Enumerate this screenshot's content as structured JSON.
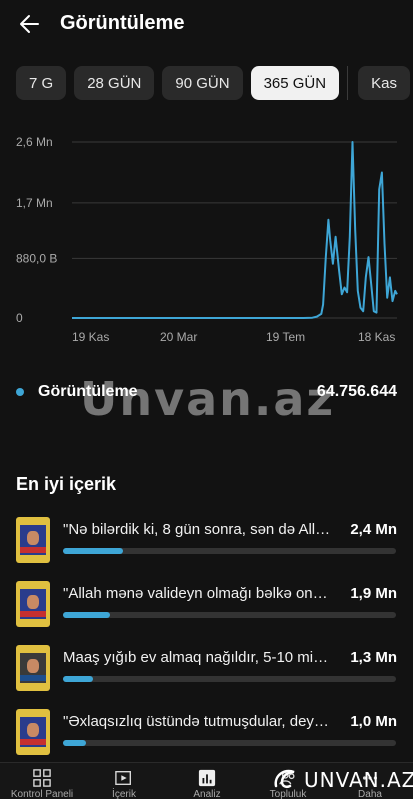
{
  "header": {
    "title": "Görüntüleme",
    "back_icon": "arrow-left-icon"
  },
  "range_chips": [
    {
      "label": "7 G",
      "active": false
    },
    {
      "label": "28 GÜN",
      "active": false
    },
    {
      "label": "90 GÜN",
      "active": false
    },
    {
      "label": "365 GÜN",
      "active": true
    },
    {
      "label": "Kas",
      "active": false
    }
  ],
  "chart_data": {
    "type": "line",
    "y_ticks": [
      "2,6 Mn",
      "1,7 Mn",
      "880,0 B",
      "0"
    ],
    "y_tick_values": [
      2600000,
      1700000,
      880000,
      0
    ],
    "x_ticks": [
      "19 Kas",
      "20 Mar",
      "19 Tem",
      "18 Kas"
    ],
    "ylim": [
      0,
      2600000
    ],
    "xlim": [
      0,
      365
    ],
    "series": [
      {
        "color": "#3ea6d6",
        "x": [
          0,
          30,
          60,
          90,
          120,
          150,
          180,
          210,
          240,
          260,
          270,
          275,
          280,
          282,
          285,
          288,
          290,
          293,
          296,
          300,
          303,
          306,
          309,
          312,
          315,
          318,
          321,
          324,
          327,
          330,
          333,
          336,
          339,
          342,
          345,
          348,
          351,
          354,
          357,
          360,
          363,
          365
        ],
        "y": [
          0,
          0,
          0,
          0,
          0,
          0,
          0,
          0,
          0,
          0,
          5000,
          20000,
          60000,
          200000,
          900000,
          1450000,
          1150000,
          800000,
          1200000,
          700000,
          350000,
          450000,
          380000,
          1200000,
          2600000,
          1300000,
          400000,
          150000,
          100000,
          600000,
          900000,
          500000,
          100000,
          80000,
          1900000,
          2150000,
          1100000,
          300000,
          600000,
          250000,
          400000,
          350000
        ]
      }
    ]
  },
  "metric": {
    "label": "Görüntüleme",
    "value": "64.756.644",
    "color": "#3ea6d6"
  },
  "watermark": "Unvan.az",
  "top_content": {
    "title": "En iyi içerik",
    "items": [
      {
        "title": "\"Nə bilərdik ki, 8 gün sonra, sən də Allah...",
        "value": "2,4 Mn",
        "fraction": 0.18
      },
      {
        "title": "\"Allah mənə valideyn olmağı bəlkə onada...",
        "value": "1,9 Mn",
        "fraction": 0.14
      },
      {
        "title": "Maaş yığıb ev almaq nağıldır, 5-10 minlik...",
        "value": "1,3 Mn",
        "fraction": 0.09
      },
      {
        "title": "\"Əxlaqsızlıq üstündə tutmuşdular, deyib...",
        "value": "1,0 Mn",
        "fraction": 0.07
      }
    ]
  },
  "bottom_nav": [
    {
      "icon": "dashboard-grid-icon",
      "label": "Kontrol Paneli"
    },
    {
      "icon": "video-library-icon",
      "label": "İçerik"
    },
    {
      "icon": "analytics-bars-icon",
      "label": "Analiz"
    },
    {
      "icon": "community-icon",
      "label": "Topluluk"
    },
    {
      "icon": "more-icon",
      "label": "Daha"
    }
  ],
  "logo": {
    "text": "UNVAN.AZ"
  }
}
